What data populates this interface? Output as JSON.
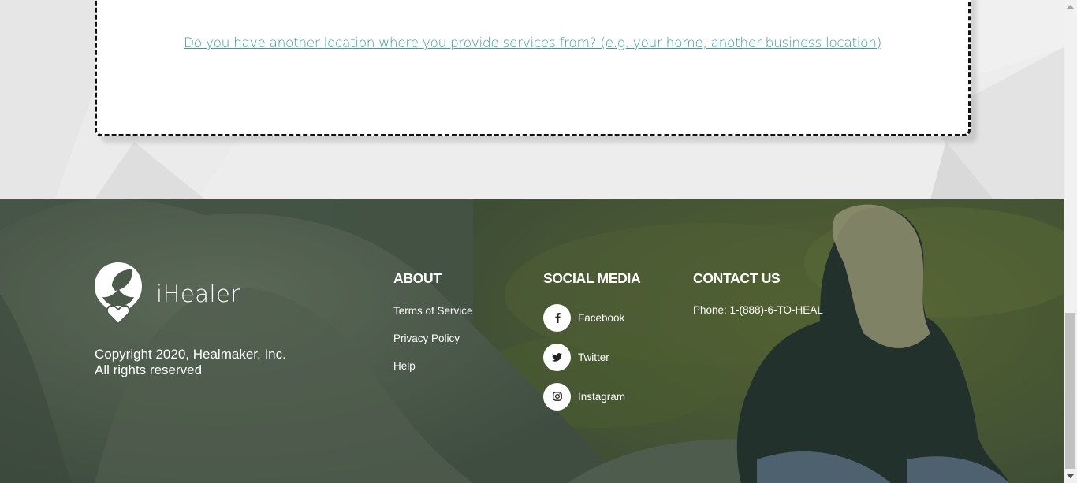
{
  "main": {
    "location_link": "Do you have another location where you provide services from? (e.g. your home, another business location)"
  },
  "footer": {
    "brand_name": "iHealer",
    "copyright_line1": "Copyright 2020, Healmaker, Inc.",
    "copyright_line2": "All rights reserved",
    "about": {
      "heading": "ABOUT",
      "links": [
        "Terms of Service",
        "Privacy Policy",
        "Help"
      ]
    },
    "social": {
      "heading": "SOCIAL MEDIA",
      "items": [
        {
          "label": "Facebook",
          "icon": "facebook-icon"
        },
        {
          "label": "Twitter",
          "icon": "twitter-icon"
        },
        {
          "label": "Instagram",
          "icon": "instagram-icon"
        }
      ]
    },
    "contact": {
      "heading": "CONTACT US",
      "phone": "Phone: 1-(888)-6-TO-HEAL"
    }
  },
  "colors": {
    "link_teal": "#3a9ea0",
    "footer_overlay": "#4b5a4a",
    "upper_bg": "#ededed"
  }
}
